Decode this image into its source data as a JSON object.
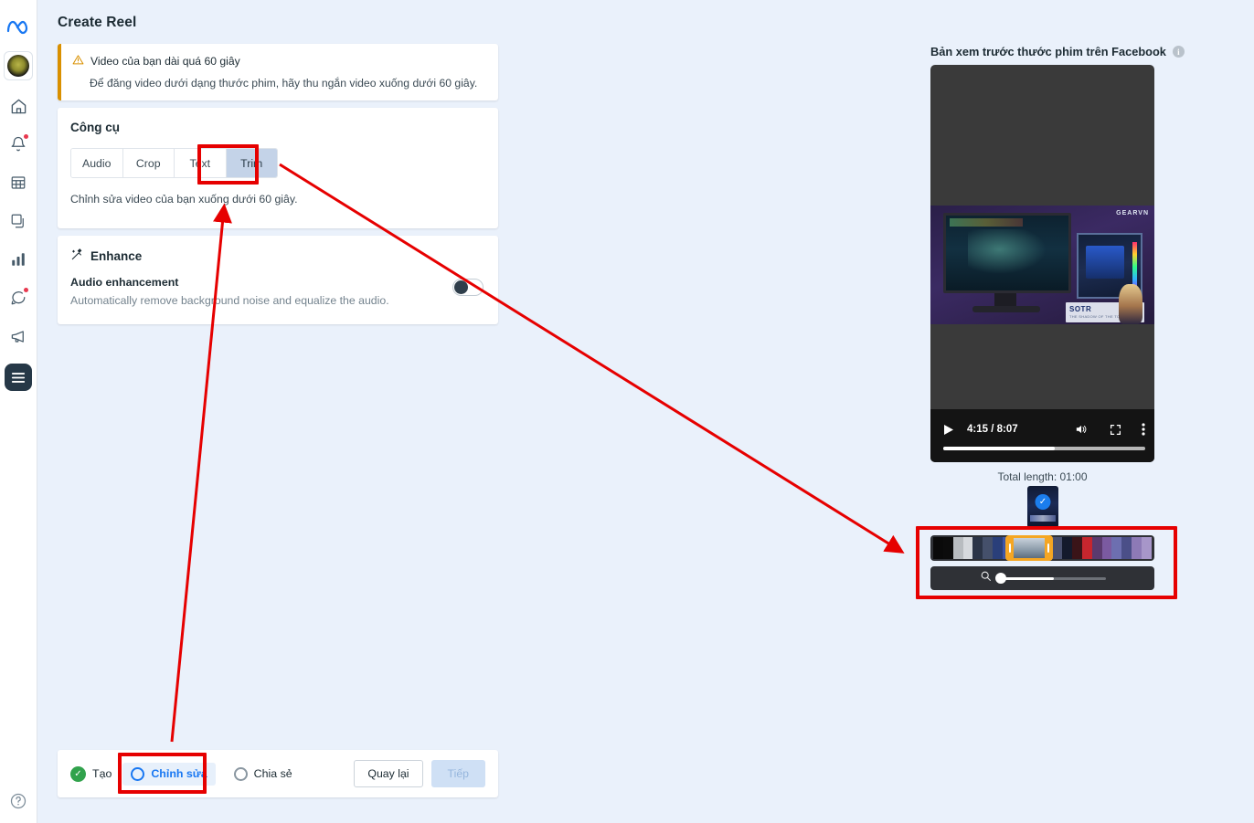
{
  "rail": {
    "items": [
      {
        "name": "meta-logo",
        "label": "Meta"
      },
      {
        "name": "account-avatar",
        "label": "Account"
      },
      {
        "name": "home",
        "label": "Home"
      },
      {
        "name": "notifications",
        "label": "Notifications"
      },
      {
        "name": "planner",
        "label": "Planner"
      },
      {
        "name": "content",
        "label": "Content"
      },
      {
        "name": "insights",
        "label": "Insights"
      },
      {
        "name": "inbox",
        "label": "Inbox"
      },
      {
        "name": "ads",
        "label": "Ads"
      },
      {
        "name": "menu",
        "label": "Menu"
      },
      {
        "name": "help",
        "label": "Help"
      }
    ]
  },
  "page": {
    "title": "Create Reel"
  },
  "warning": {
    "icon": "warning-triangle-icon",
    "title": "Video của bạn dài quá 60 giây",
    "description": "Để đăng video dưới dạng thước phim, hãy thu ngắn video xuống dưới 60 giây.",
    "accent_color": "#d99000"
  },
  "tools": {
    "heading": "Công cụ",
    "tabs": [
      {
        "label": "Audio",
        "selected": false
      },
      {
        "label": "Crop",
        "selected": false
      },
      {
        "label": "Text",
        "selected": false
      },
      {
        "label": "Trim",
        "selected": true
      }
    ],
    "description": "Chỉnh sửa video của bạn xuống dưới 60 giây."
  },
  "enhance": {
    "icon": "magic-wand-icon",
    "heading": "Enhance",
    "option_label": "Audio enhancement",
    "option_description": "Automatically remove background noise and equalize the audio.",
    "toggle_state": "off"
  },
  "stepper": {
    "steps": [
      {
        "label": "Tạo",
        "state": "completed"
      },
      {
        "label": "Chỉnh sửa",
        "state": "active"
      },
      {
        "label": "Chia sẻ",
        "state": "pending"
      }
    ],
    "back_label": "Quay lại",
    "next_label": "Tiếp",
    "active_color": "#1877f2",
    "completed_color": "#31a24c"
  },
  "preview": {
    "label": "Bản xem trước thước phim trên Facebook",
    "info_icon": "info-icon",
    "player": {
      "play_icon": "play-icon",
      "time": "4:15 / 8:07",
      "volume_icon": "volume-icon",
      "fullscreen_icon": "fullscreen-icon",
      "more_icon": "more-vertical-icon",
      "progress_percent": 55
    },
    "frame": {
      "brand": "GEARVN",
      "lower_third_title": "SOTR",
      "lower_third_subtitle": "THE SHADOW OF THE TOMB RAIDER"
    },
    "total_length": "Total length: 01:00",
    "thumbnail_badge": "check-badge-icon"
  },
  "timeline": {
    "trim_handle_color": "#f5a623",
    "zoom_icon": "magnifier-icon",
    "zoom_percent": 52,
    "strip_colors": [
      "#0a0a0a",
      "#0c0c0c",
      "#b8bcc0",
      "#d6d9dd",
      "#2b3447",
      "#45506b",
      "#2a3f7a",
      "#3d56a8",
      "#c9d2dc",
      "#8fa0b0",
      "#2d3b66",
      "#20304f",
      "#4a5170",
      "#141a2c",
      "#3a1418",
      "#c6262e",
      "#5b3a6e",
      "#7b5aa0",
      "#6d6fb0",
      "#4b4f88",
      "#8d7ab6",
      "#a796c9"
    ]
  },
  "annotations": {
    "highlight_color": "#e60000",
    "boxes": [
      "trim-tab",
      "timeline-panel",
      "edit-step"
    ],
    "arrows": [
      "trim-to-timeline",
      "description-to-trim",
      "edit-step-to-trim"
    ]
  }
}
